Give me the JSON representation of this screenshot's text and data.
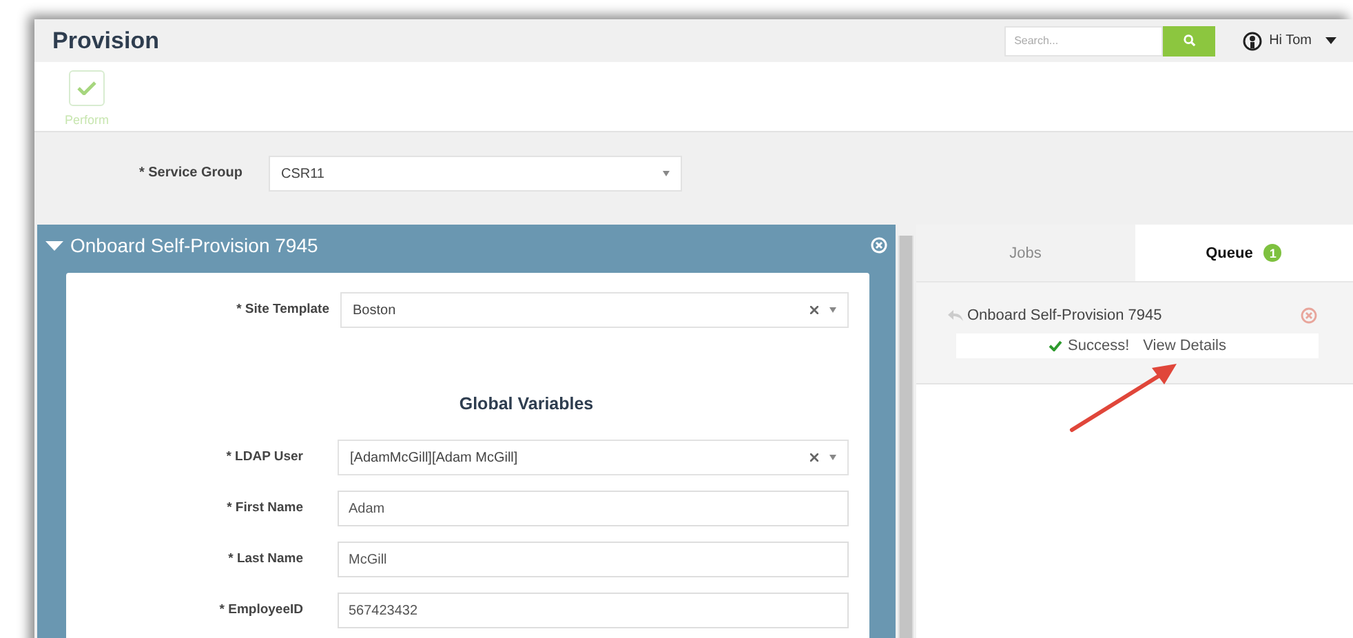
{
  "header": {
    "title": "Provision",
    "search": {
      "placeholder": "Search..."
    },
    "user": {
      "greeting": "Hi Tom"
    }
  },
  "toolbar": {
    "buttons": [
      {
        "label": "Perform",
        "disabled": true
      }
    ]
  },
  "service_group": {
    "label": "* Service Group",
    "value": "CSR11"
  },
  "job_panel": {
    "title": "Onboard Self-Provision 7945",
    "expanded": true,
    "site_template": {
      "kind": "select",
      "label": "* Site Template",
      "value": "Boston",
      "clearable": true
    },
    "section_title": "Global Variables",
    "fields": [
      {
        "kind": "select",
        "label": "* LDAP User",
        "value": "[AdamMcGill][Adam McGill]",
        "clearable": true
      },
      {
        "kind": "text",
        "label": "* First Name",
        "value": "Adam"
      },
      {
        "kind": "text",
        "label": "* Last Name",
        "value": "McGill"
      },
      {
        "kind": "text",
        "label": "* EmployeeID",
        "value": "567423432"
      }
    ]
  },
  "side_panel": {
    "tabs": [
      {
        "label": "Jobs",
        "selected": false
      },
      {
        "label": "Queue",
        "selected": true,
        "badge": "1"
      }
    ],
    "queue": [
      {
        "title": "Onboard Self-Provision 7945",
        "status": "Success!",
        "link": "View Details"
      }
    ]
  }
}
